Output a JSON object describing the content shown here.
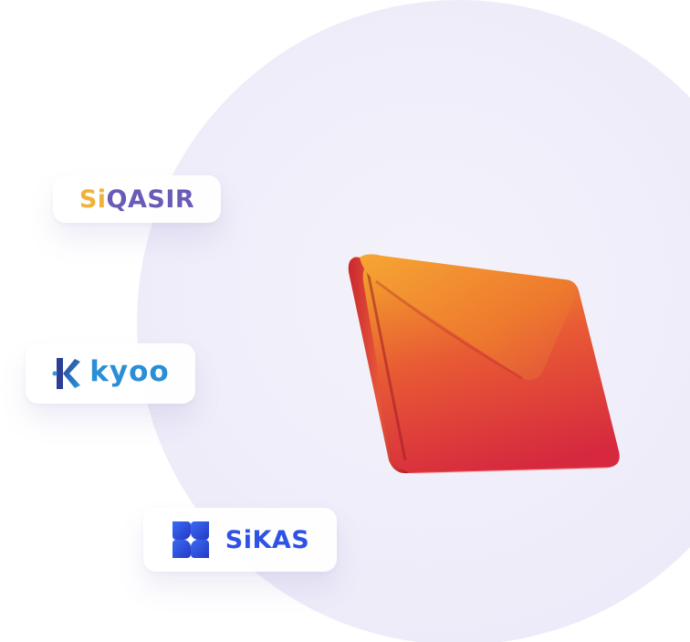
{
  "brands": {
    "siqasir": {
      "prefix": "Si",
      "rest": "QASIR",
      "icon": "siqasir-logo"
    },
    "kyoo": {
      "label": "kyoo",
      "icon": "kyoo-k-icon"
    },
    "sikas": {
      "label": "SiKAS",
      "icon": "sikas-clover-icon"
    }
  },
  "illustration": {
    "icon": "envelope-icon"
  },
  "colors": {
    "siqasir_si": "#f0b23a",
    "siqasir_rest": "#6a5bb6",
    "kyoo": "#2a8fd6",
    "sikas": "#2f52e6",
    "envelope_top": "#f2a02c",
    "envelope_bottom": "#d6283f",
    "circle": "#eeecf9"
  }
}
